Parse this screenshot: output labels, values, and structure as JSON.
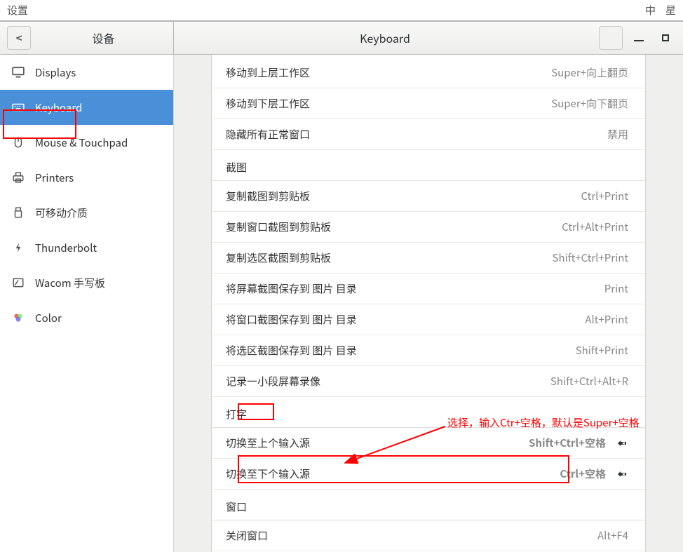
{
  "topbar": {
    "settings_label": "设置",
    "right1": "中",
    "right2": "星"
  },
  "header": {
    "back_glyph": "<",
    "left_title": "设备",
    "right_title": "Keyboard"
  },
  "sidebar": {
    "items": [
      {
        "label": "Displays",
        "name": "sidebar-item-displays"
      },
      {
        "label": "Keyboard",
        "name": "sidebar-item-keyboard",
        "selected": true
      },
      {
        "label": "Mouse & Touchpad",
        "name": "sidebar-item-mouse"
      },
      {
        "label": "Printers",
        "name": "sidebar-item-printers"
      },
      {
        "label": "可移动介质",
        "name": "sidebar-item-removable"
      },
      {
        "label": "Thunderbolt",
        "name": "sidebar-item-thunderbolt"
      },
      {
        "label": "Wacom 手写板",
        "name": "sidebar-item-wacom"
      },
      {
        "label": "Color",
        "name": "sidebar-item-color"
      }
    ]
  },
  "shortcuts": {
    "move_up_label": "移动到上层工作区",
    "move_up_key": "Super+向上翻页",
    "move_down_label": "移动到下层工作区",
    "move_down_key": "Super+向下翻页",
    "hide_all_label": "隐藏所有正常窗口",
    "hide_all_key": "禁用",
    "section_screenshot": "截图",
    "copy_screenshot_label": "复制截图到剪贴板",
    "copy_screenshot_key": "Ctrl+Print",
    "copy_window_label": "复制窗口截图到剪贴板",
    "copy_window_key": "Ctrl+Alt+Print",
    "copy_selection_label": "复制选区截图到剪贴板",
    "copy_selection_key": "Shift+Ctrl+Print",
    "save_screen_label": "将屏幕截图保存到 图片 目录",
    "save_screen_key": "Print",
    "save_window_label": "将窗口截图保存到 图片 目录",
    "save_window_key": "Alt+Print",
    "save_selection_label": "将选区截图保存到 图片 目录",
    "save_selection_key": "Shift+Print",
    "record_label": "记录一小段屏幕录像",
    "record_key": "Shift+Ctrl+Alt+R",
    "section_typing": "打字",
    "prev_source_label": "切换至上个输入源",
    "prev_source_key": "Shift+Ctrl+空格",
    "next_source_label": "切换至下个输入源",
    "next_source_key": "Ctrl+空格",
    "section_window": "窗口",
    "close_window_label": "关闭窗口",
    "close_window_key": "Alt+F4"
  },
  "annotation": {
    "text": "选择，输入Ctr+空格，默认是Super+空格"
  }
}
